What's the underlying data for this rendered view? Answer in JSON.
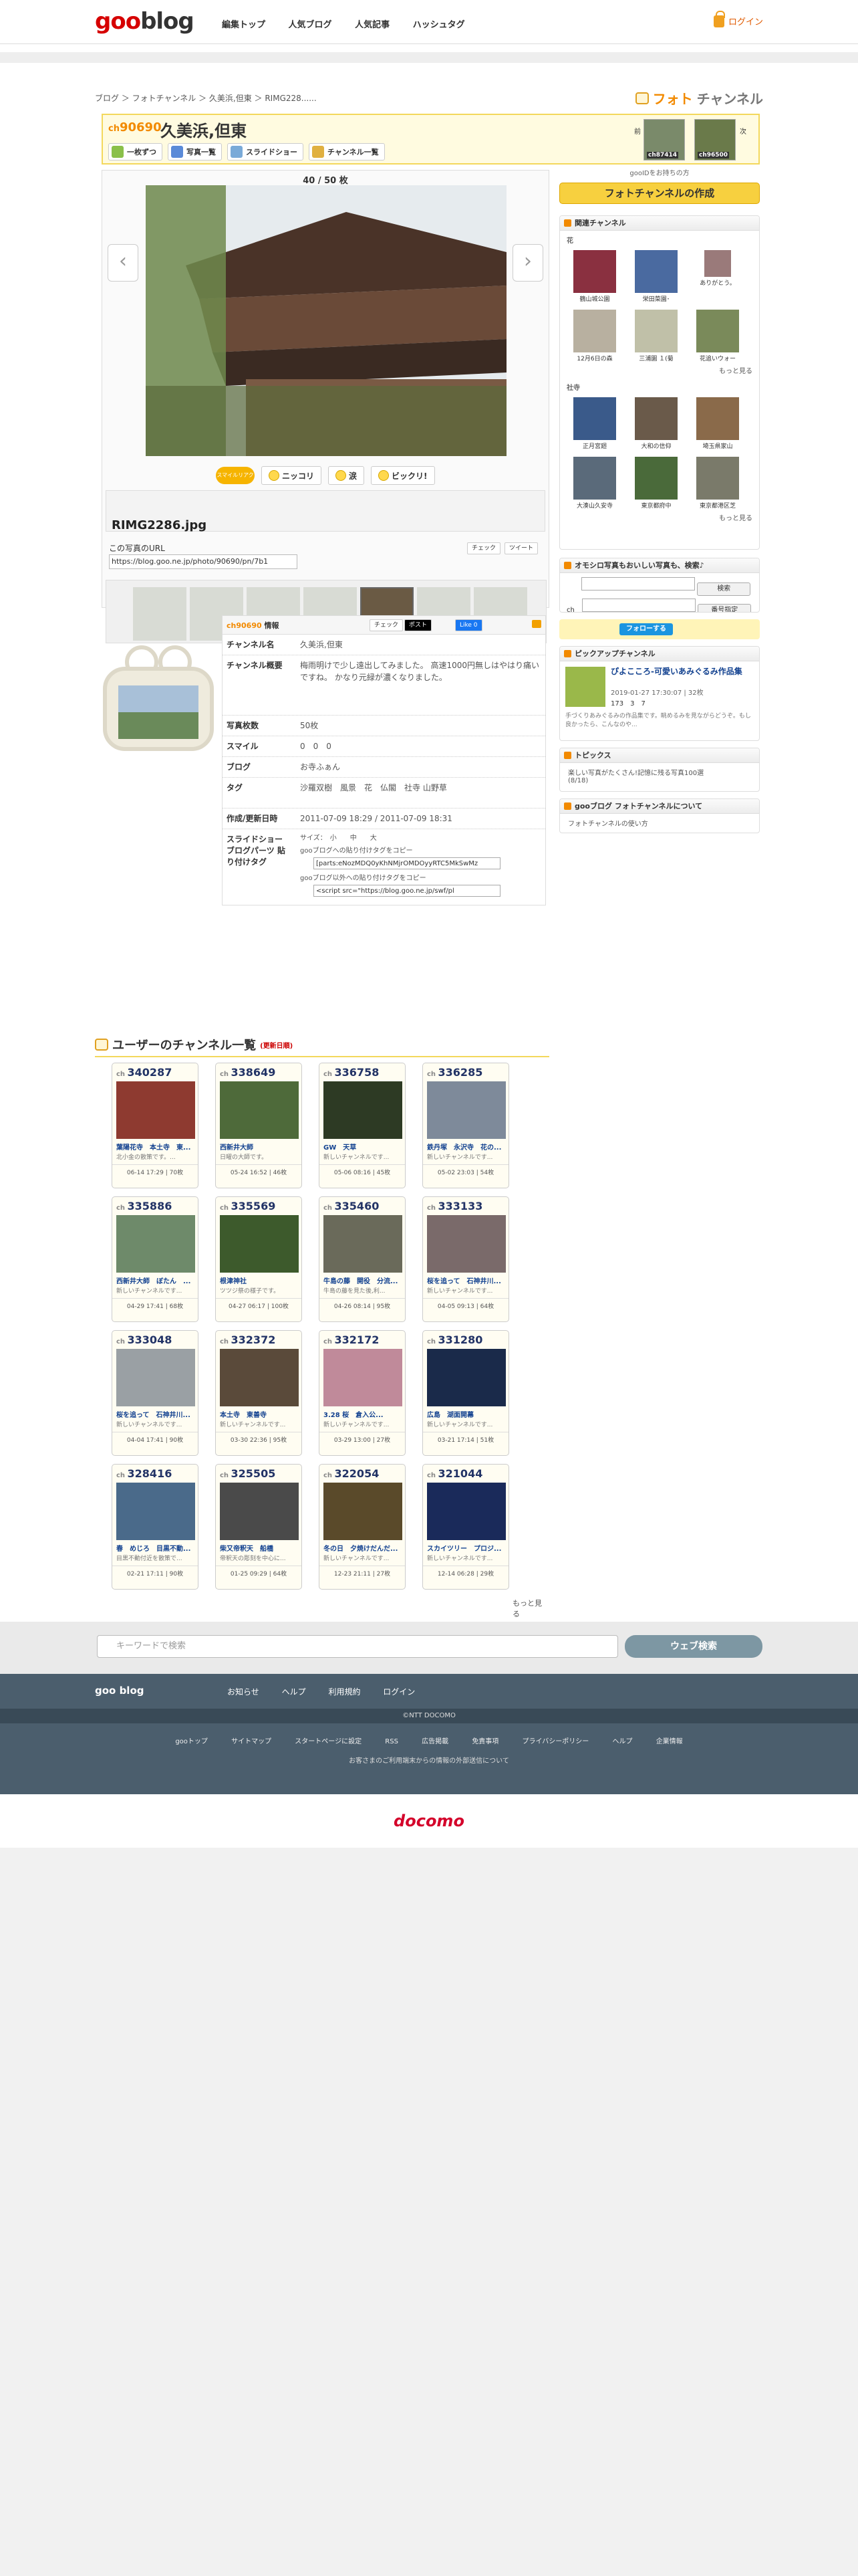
{
  "header": {
    "logo_goo": "goo",
    "logo_blog": "blog",
    "nav": [
      "編集トップ",
      "人気ブログ",
      "人気記事",
      "ハッシュタグ"
    ],
    "login": "ログイン"
  },
  "breadcrumb": "ブログ ＞ フォトチャンネル ＞ 久美浜,但東 ＞ RIMG228......",
  "photoch_title_a": "フォト",
  "photoch_title_b": "チャンネル",
  "channel": {
    "ch_prefix": "ch",
    "ch_no": "90690",
    "name": "久美浜,但東",
    "buttons": [
      "一枚ずつ",
      "写真一覧",
      "スライドショー",
      "チャンネル一覧"
    ],
    "prev_label": "前",
    "next_label": "次",
    "prev_ch": "ch87414",
    "next_ch": "ch96500"
  },
  "viewer": {
    "counter": "40 / 50 枚",
    "filename": "RIMG2286.jpg",
    "url_label": "この写真のURL",
    "url": "https://blog.goo.ne.jp/photo/90690/pn/7b1",
    "spin": "スマイルリアクション",
    "reactions": [
      "ニッコリ",
      "涙",
      "ビックリ!"
    ],
    "share": [
      "チェック",
      "ツイート"
    ]
  },
  "sidebar": {
    "login_note": "gooIDをお持ちの方",
    "create_btn": "フォトチャンネルの作成",
    "related_title": "関連チャンネル",
    "flower_label": "花",
    "flower_items": [
      "鶴山城公園",
      "栄田菜園･",
      "ありがとう。",
      "12月6日の森",
      "三浦園 １(菊",
      "花追いウォー"
    ],
    "temple_label": "社寺",
    "temple_items": [
      "正月宮廻",
      "大和の信仰",
      "埼玉県家山",
      "大湊山久安寺",
      "東京都府中",
      "東京都港区芝"
    ],
    "more": "もっと見る",
    "search_title": "オモシロ写真もおいしい写真も、検索♪",
    "search_btn": "検索",
    "num_btn": "番号指定",
    "ch_label": "ch",
    "follow": "フォローする",
    "pickup_title": "ピックアップチャンネル",
    "pickup_name": "ぴよこころ-可愛いあみぐるみ作品集",
    "pickup_meta": "2019-01-27 17:30:07 | 32枚",
    "pickup_counts": [
      "173",
      "3",
      "7"
    ],
    "pickup_desc": "手づくりあみぐるみの作品集です。眺めるみを見ながらどうぞ。もし良かったら、こんなのや...",
    "topics_title": "トピックス",
    "topics_item": "楽しい写真がたくさん!記憶に残る写真100選",
    "topics_date": "(8/18)",
    "about_title": "gooブログ フォトチャンネルについて",
    "about_item": "フォトチャンネルの使い方"
  },
  "info": {
    "title_ch": "ch90690",
    "title": "情報",
    "rows": [
      {
        "k": "チャンネル名",
        "v": "久美浜,但東"
      },
      {
        "k": "チャンネル概要",
        "v": "梅雨明けで少し遠出してみました。 高速1000円無しはやはり痛いですね。 かなり元緑が濃くなりました。"
      },
      {
        "k": "写真枚数",
        "v": "50枚"
      },
      {
        "k": "スマイル",
        "v": "0　0　0"
      },
      {
        "k": "ブログ",
        "v": "お寺ふぁん"
      },
      {
        "k": "タグ",
        "v": "沙羅双樹　風景　花　仏閣　社寺 山野草"
      },
      {
        "k": "作成/更新日時",
        "v": "2011-07-09 18:29 / 2011-07-09 18:31"
      }
    ],
    "slide_k": "スライドショー ブログパーツ 貼り付けタグ",
    "size_label": "サイズ：　小　　中　　大",
    "code1_label": "gooブログへの貼り付けタグをコピー",
    "code1": "[parts:eNozMDQ0yKhNMjrOMDOyyRTC5MkSwMz",
    "code2_label": "gooブログ以外への貼り付けタグをコピー",
    "code2": "<script src=\"https://blog.goo.ne.jp/swf/pl",
    "share": [
      "チェック",
      "ポスト",
      "Like 0"
    ]
  },
  "user_channels": {
    "title": "ユーザーのチャンネル一覧",
    "sub": "(更新日順)",
    "more": "もっと見る",
    "cards": [
      {
        "no": "340287",
        "t": "葉陽花寺　本土寺　東...",
        "d": "北小金の散策です。...",
        "m": "06-14 17:29 | 70枚",
        "c": "#8e3a30"
      },
      {
        "no": "338649",
        "t": "西新井大師",
        "d": "日曜の大師です。",
        "m": "05-24 16:52 | 46枚",
        "c": "#4e6a3a"
      },
      {
        "no": "336758",
        "t": "GW　天草",
        "d": "新しいチャンネルです...",
        "m": "05-06 08:16 | 45枚",
        "c": "#2d3a24"
      },
      {
        "no": "336285",
        "t": "鉄丹塚　永沢寺　花の...",
        "d": "新しいチャンネルです...",
        "m": "05-02 23:03 | 54枚",
        "c": "#7e8a9a"
      },
      {
        "no": "335886",
        "t": "西新井大師　ぼたん　...",
        "d": "新しいチャンネルです...",
        "m": "04-29 17:41 | 68枚",
        "c": "#6e8a6a"
      },
      {
        "no": "335569",
        "t": "根津神社",
        "d": "ツツジ祭の様子です。",
        "m": "04-27 06:17 | 100枚",
        "c": "#3d5a2c"
      },
      {
        "no": "335460",
        "t": "牛島の藤　開役　分流...",
        "d": "牛島の藤を見た後,利...",
        "m": "04-26 08:14 | 95枚",
        "c": "#6a6a5a"
      },
      {
        "no": "333133",
        "t": "桜を追って　石神井川...",
        "d": "新しいチャンネルです...",
        "m": "04-05 09:13 | 64枚",
        "c": "#7a6a6a"
      },
      {
        "no": "333048",
        "t": "桜を追って　石神井川...",
        "d": "新しいチャンネルです...",
        "m": "04-04 17:41 | 90枚",
        "c": "#9aa0a4"
      },
      {
        "no": "332372",
        "t": "本土寺　東善寺",
        "d": "新しいチャンネルです...",
        "m": "03-30 22:36 | 95枚",
        "c": "#5a4a3a"
      },
      {
        "no": "332172",
        "t": "3.28 桜　倉入公...",
        "d": "新しいチャンネルです...",
        "m": "03-29 13:00 | 27枚",
        "c": "#c08a9a"
      },
      {
        "no": "331280",
        "t": "広島　湖面開幕",
        "d": "新しいチャンネルです...",
        "m": "03-21 17:14 | 51枚",
        "c": "#1a2a4a"
      },
      {
        "no": "328416",
        "t": "春　めじろ　目黒不動...",
        "d": "目黒不動付近を散策で...",
        "m": "02-21 17:11 | 90枚",
        "c": "#4a6a8a"
      },
      {
        "no": "325505",
        "t": "柴又帝釈天　船橋",
        "d": "帝釈天の彫刻を中心に...",
        "m": "01-25 09:29 | 64枚",
        "c": "#4a4a4a"
      },
      {
        "no": "322054",
        "t": "冬の日　夕焼けだんだ...",
        "d": "新しいチャンネルです...",
        "m": "12-23 21:11 | 27枚",
        "c": "#5a4a2a"
      },
      {
        "no": "321044",
        "t": "スカイツリー　プロジ...",
        "d": "新しいチャンネルです...",
        "m": "12-14 06:28 | 29枚",
        "c": "#1a2a5a"
      }
    ]
  },
  "search": {
    "placeholder": "キーワードで検索",
    "btn": "ウェブ検索"
  },
  "footer": {
    "logo": "goo blog",
    "links": [
      "お知らせ",
      "ヘルプ",
      "利用規約",
      "ログイン"
    ],
    "copyright": "©NTT DOCOMO",
    "links2": [
      "gooトップ",
      "サイトマップ",
      "スタートページに設定",
      "RSS",
      "広告掲載",
      "免責事項",
      "プライバシーポリシー",
      "ヘルプ",
      "企業情報"
    ],
    "note": "お客さまのご利用端末からの情報の外部送信について",
    "docomo": "docomo"
  }
}
